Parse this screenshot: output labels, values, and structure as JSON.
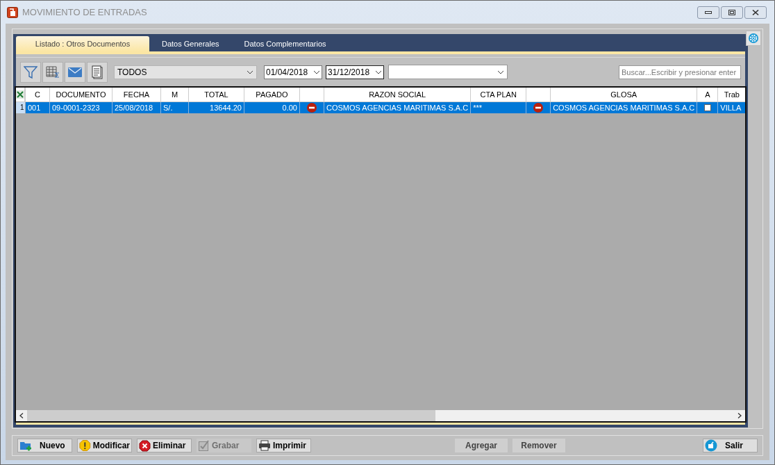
{
  "window": {
    "title": "MOVIMIENTO DE ENTRADAS"
  },
  "tabs": [
    {
      "label": "Listado : Otros Documentos",
      "selected": true
    },
    {
      "label": "Datos Generales",
      "selected": false
    },
    {
      "label": "Datos Complementarios",
      "selected": false
    }
  ],
  "toolbar": {
    "filter_combo": {
      "value": "TODOS"
    },
    "date_from": {
      "value": "01/04/2018"
    },
    "date_to": {
      "value": "31/12/2018"
    },
    "search": {
      "placeholder": "Buscar...Escribir y presionar enter"
    }
  },
  "table": {
    "columns": [
      {
        "label": "C",
        "kind": "text"
      },
      {
        "label": "DOCUMENTO",
        "kind": "text"
      },
      {
        "label": "FECHA",
        "kind": "text"
      },
      {
        "label": "M",
        "kind": "text"
      },
      {
        "label": "TOTAL",
        "kind": "number"
      },
      {
        "label": "PAGADO",
        "kind": "number"
      },
      {
        "kind": "icon"
      },
      {
        "label": "RAZON SOCIAL",
        "kind": "text"
      },
      {
        "label": "CTA PLAN",
        "kind": "text"
      },
      {
        "kind": "icon"
      },
      {
        "label": "GLOSA",
        "kind": "text"
      },
      {
        "label": "A",
        "kind": "check"
      },
      {
        "label": "Trab",
        "kind": "text"
      }
    ],
    "rows": [
      {
        "number": "1",
        "selected": true,
        "cells": [
          {
            "kind": "text",
            "text": "001"
          },
          {
            "kind": "text",
            "text": "09-0001-2323"
          },
          {
            "kind": "text",
            "text": "25/08/2018"
          },
          {
            "kind": "text",
            "text": "S/."
          },
          {
            "kind": "text",
            "text": "13644.20"
          },
          {
            "kind": "text",
            "text": "0.00"
          },
          {
            "kind": "icon"
          },
          {
            "kind": "text",
            "text": "COSMOS AGENCIAS MARITIMAS S.A.C"
          },
          {
            "kind": "text",
            "text": "***"
          },
          {
            "kind": "icon"
          },
          {
            "kind": "text",
            "text": "COSMOS AGENCIAS MARITIMAS S.A.C"
          },
          {
            "kind": "check",
            "checked": false
          },
          {
            "kind": "text",
            "text": "VILLA"
          }
        ]
      }
    ]
  },
  "buttons": [
    {
      "label": "Nuevo",
      "kind": "new",
      "disabled": false
    },
    {
      "label": "Modificar",
      "kind": "edit",
      "disabled": false
    },
    {
      "label": "Eliminar",
      "kind": "delete",
      "disabled": false
    },
    {
      "label": "Grabar",
      "kind": "save",
      "disabled": true
    },
    {
      "label": "Imprimir",
      "kind": "print",
      "disabled": false
    },
    {
      "label": "Agregar",
      "kind": "plain",
      "disabled": false
    },
    {
      "label": "Remover",
      "kind": "plain",
      "disabled": false
    },
    {
      "label": "Salir",
      "kind": "exit",
      "disabled": false
    }
  ]
}
